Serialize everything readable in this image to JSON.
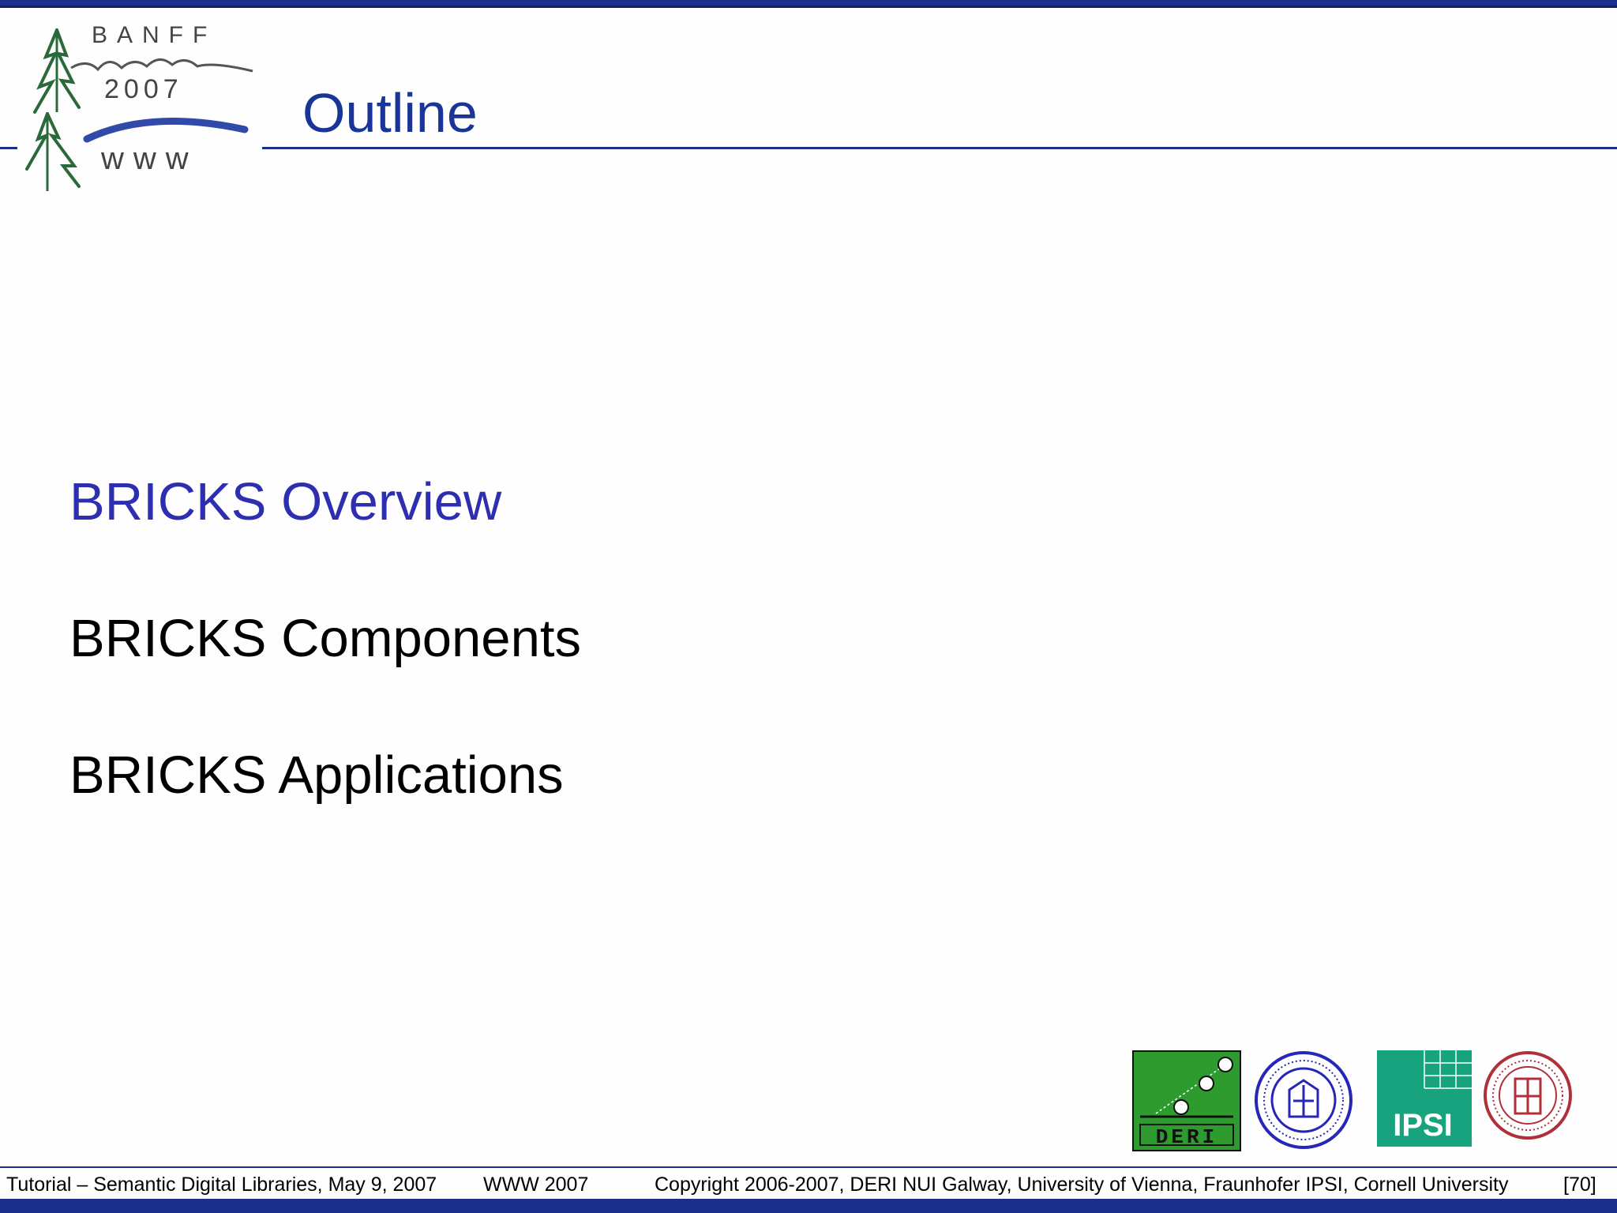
{
  "header": {
    "logo": {
      "line1": "BANFF",
      "line2": "2007",
      "line3": "www"
    },
    "title": "Outline"
  },
  "outline": {
    "items": [
      {
        "label": "BRICKS Overview",
        "active": true
      },
      {
        "label": "BRICKS Components",
        "active": false
      },
      {
        "label": "BRICKS Applications",
        "active": false
      }
    ]
  },
  "logos": {
    "deri": "DERI",
    "ipsi": "IPSI"
  },
  "footer": {
    "tutorial": "Tutorial – Semantic Digital Libraries, May 9, 2007",
    "conference": "WWW 2007",
    "copyright": "Copyright 2006-2007, DERI NUI Galway, University of Vienna, Fraunhofer IPSI, Cornell University",
    "page": "[70]"
  },
  "colors": {
    "brand_blue": "#1a2f8a",
    "title_blue": "#1a3598",
    "active_item": "#2e2eb0",
    "deri_green": "#2e9b2e",
    "ipsi_teal": "#17a37e",
    "vienna_blue": "#2626b8",
    "cornell_red": "#b0303a"
  }
}
